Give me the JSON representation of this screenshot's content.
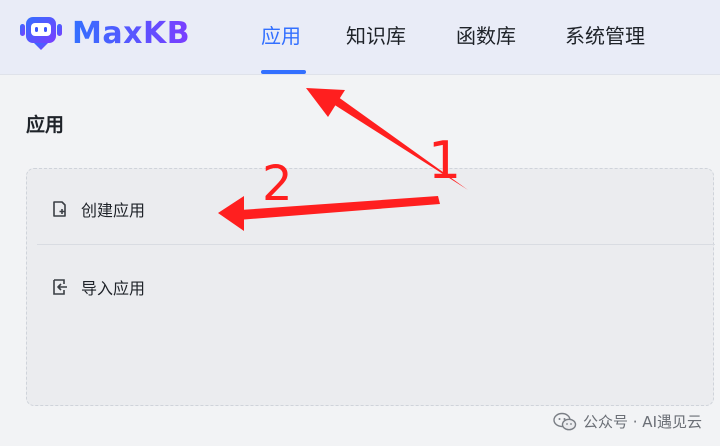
{
  "brand": {
    "name": "MaxKB",
    "gradient": [
      "#3370ff",
      "#7b3dff"
    ]
  },
  "nav": {
    "items": [
      "应用",
      "知识库",
      "函数库",
      "系统管理"
    ],
    "active_color": "#3370ff"
  },
  "page": {
    "title": "应用"
  },
  "create_menu": {
    "items": [
      {
        "label": "创建应用",
        "icon": "new-file-icon"
      },
      {
        "label": "导入应用",
        "icon": "import-icon"
      }
    ]
  },
  "annotations": {
    "labels": [
      "1",
      "2"
    ],
    "color": "#ff1f1f"
  },
  "watermark": {
    "text": "公众号 · AI遇见云"
  }
}
